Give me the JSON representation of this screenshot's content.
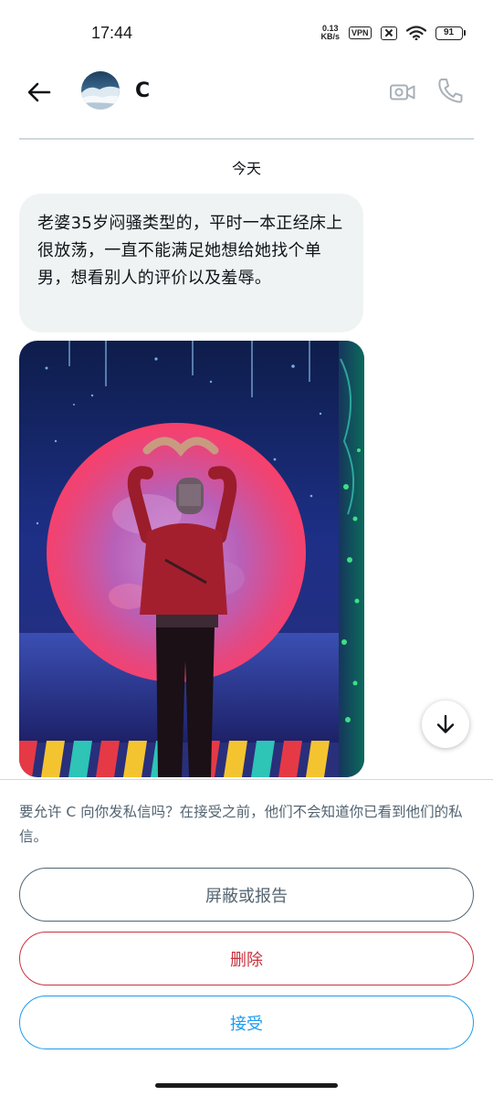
{
  "status_bar": {
    "time": "17:44",
    "net_speed_value": "0.13",
    "net_speed_unit": "KB/s",
    "vpn": "VPN",
    "battery_level": "91"
  },
  "header": {
    "contact_name": "C"
  },
  "conversation": {
    "date_separator": "今天",
    "message_text": "老婆35岁闷骚类型的，平时一本正经床上很放荡，一直不能满足她想给她找个单男，想看别人的评价以及羞辱。"
  },
  "request": {
    "prompt": "要允许 C 向你发私信吗？在接受之前，他们不会知道你已看到他们的私信。",
    "block_label": "屏蔽或报告",
    "delete_label": "删除",
    "accept_label": "接受"
  },
  "icons": {
    "back": "back-arrow-icon",
    "video": "video-camera-icon",
    "call": "phone-icon",
    "scroll": "arrow-down-icon"
  },
  "colors": {
    "accent": "#1d9bf0",
    "danger": "#c9323d",
    "muted": "#536471",
    "bubble": "#eff3f4"
  }
}
